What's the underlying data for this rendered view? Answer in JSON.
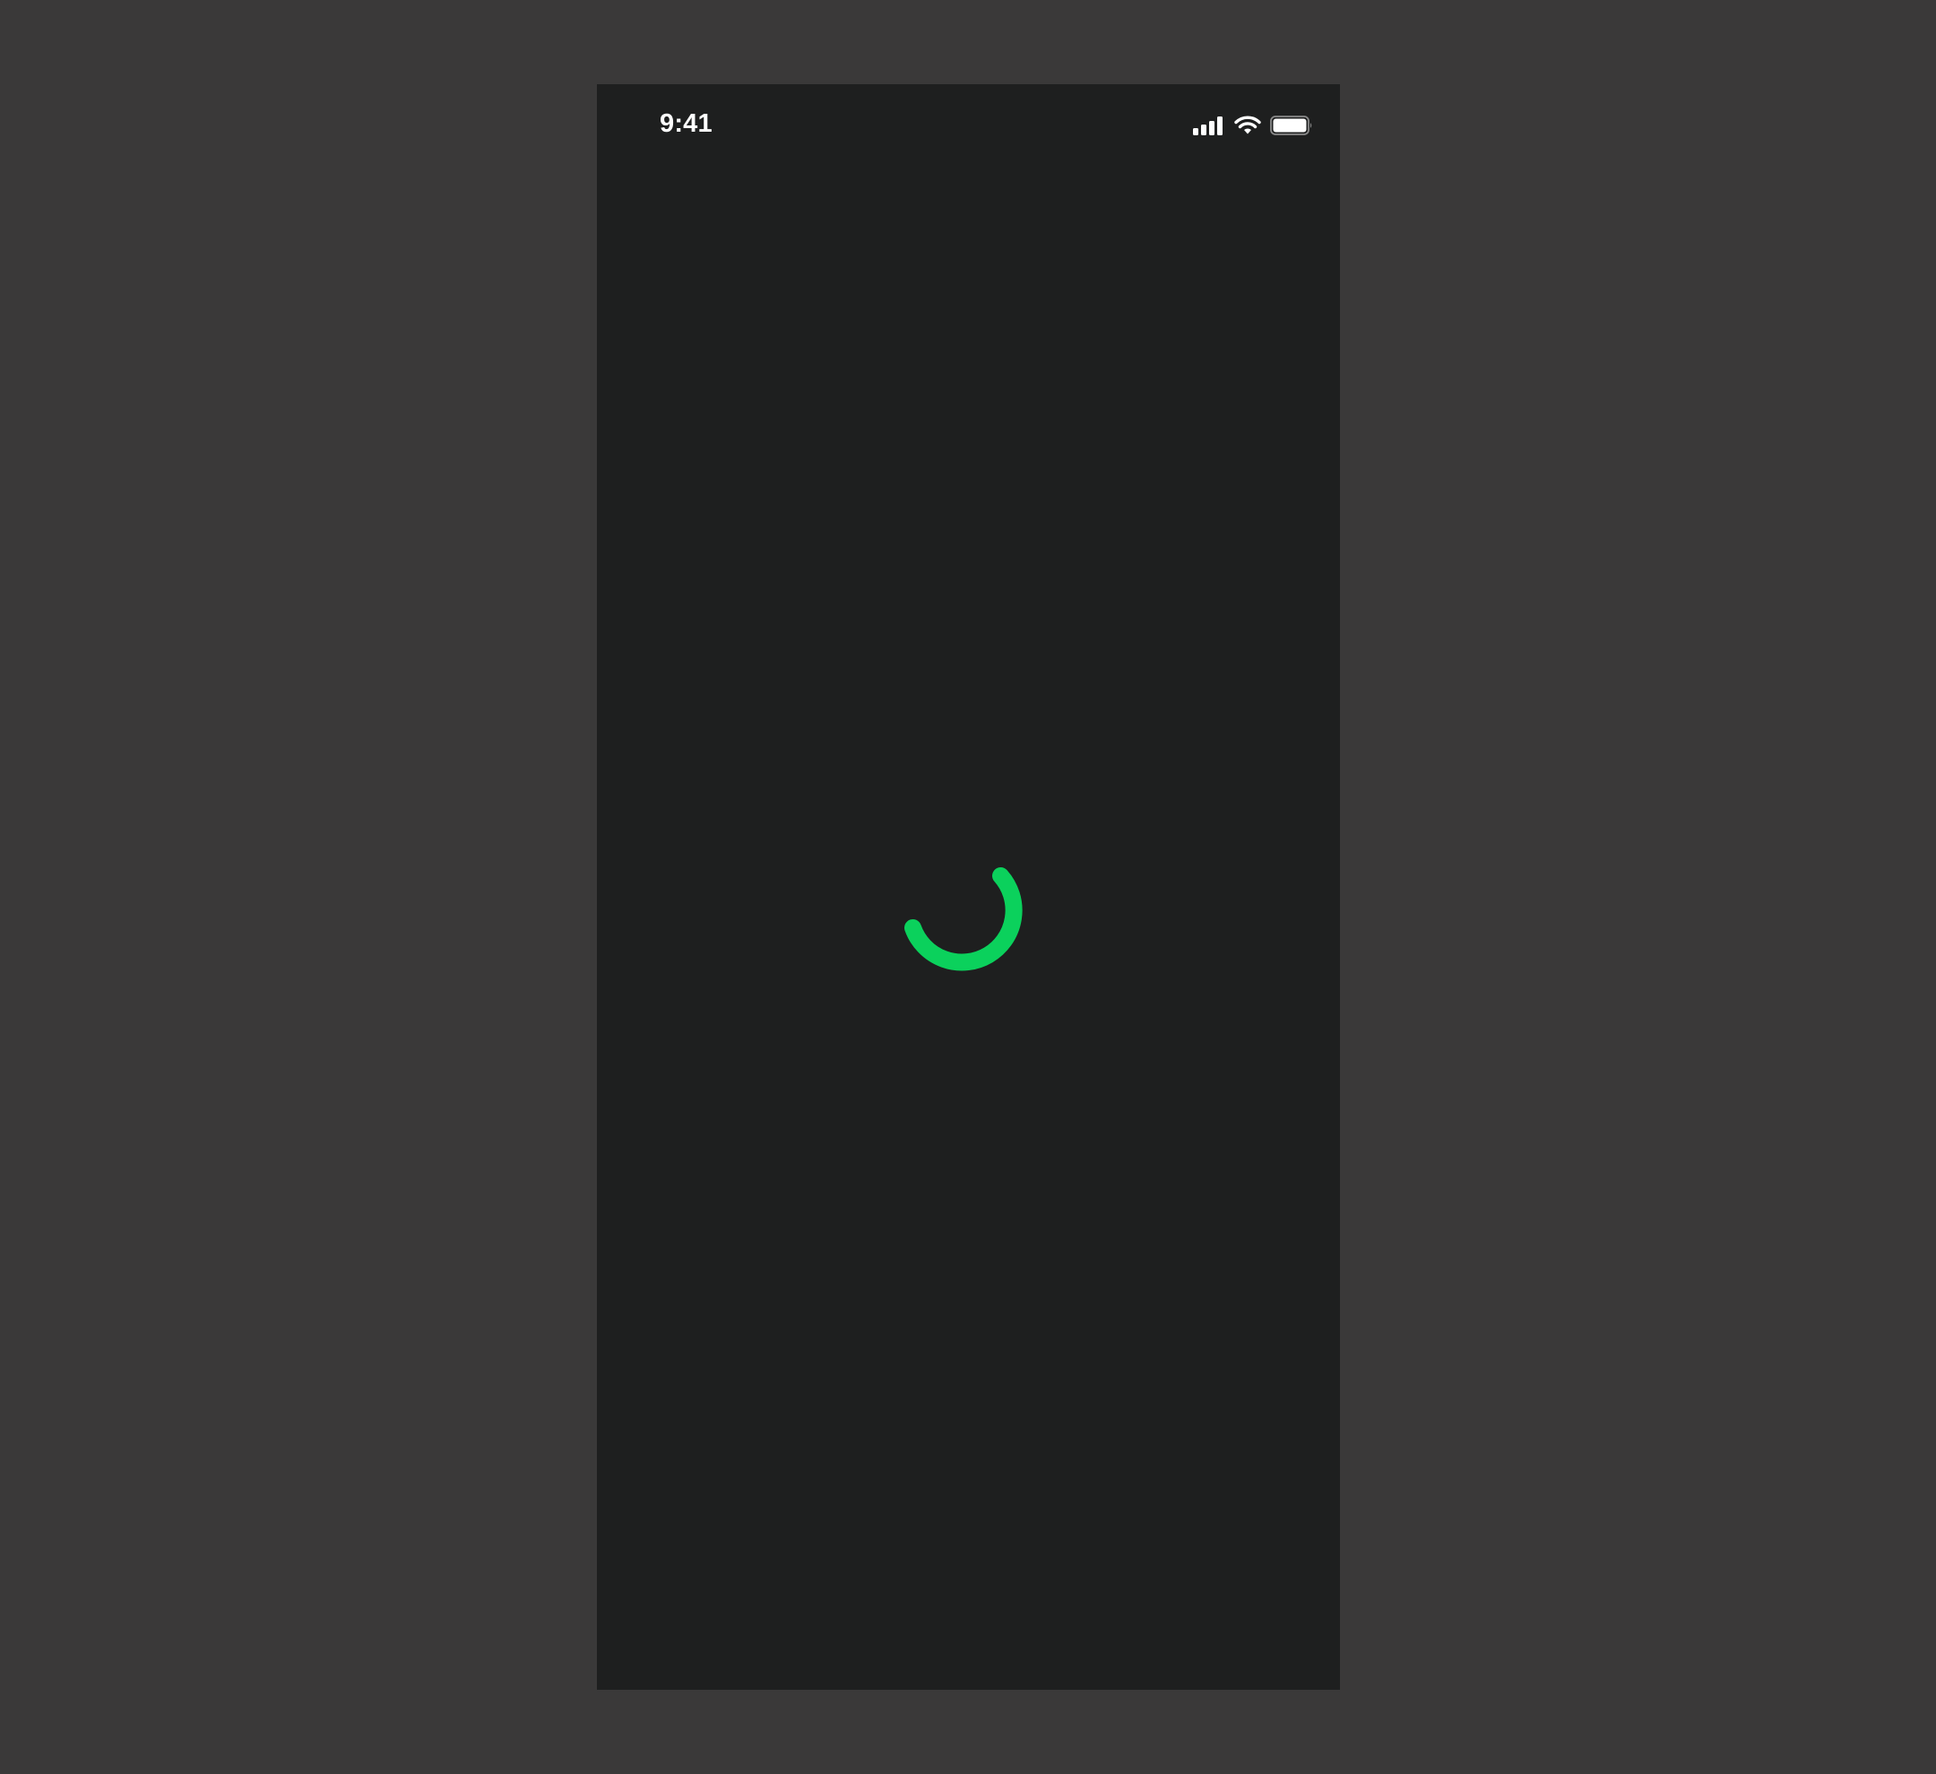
{
  "status_bar": {
    "time": "9:41",
    "icons": [
      "cellular-signal-icon",
      "wifi-icon",
      "battery-icon"
    ],
    "battery_level": 1.0,
    "signal_bars": 4
  },
  "loading": {
    "indicator": "spinner",
    "color": "#0bd15c"
  },
  "colors": {
    "backdrop": "#3a3939",
    "screen": "#1e1f1f",
    "status_text": "#ffffff",
    "accent": "#0bd15c"
  }
}
